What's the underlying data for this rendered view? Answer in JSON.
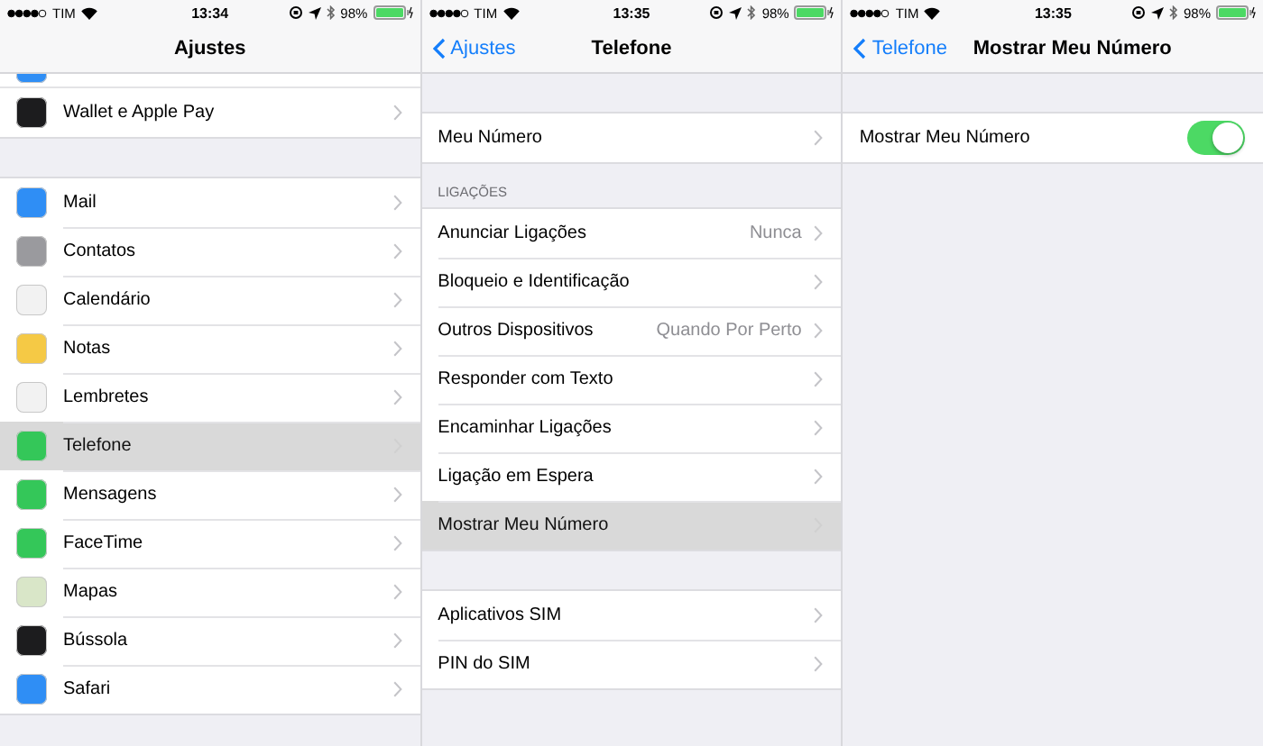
{
  "screens": [
    {
      "status_bar": {
        "carrier": "TIM",
        "time": "13:34",
        "battery": "98%"
      },
      "nav": {
        "title": "Ajustes"
      },
      "groups": [
        {
          "items": [
            {
              "kind": "clipped",
              "color": "#2f8ef5"
            },
            {
              "kind": "link",
              "label": "Wallet e Apple Pay",
              "color": "#1c1c1e",
              "selected": false
            }
          ]
        },
        {
          "items": [
            {
              "kind": "link",
              "label": "Mail",
              "color": "#2f8ef5",
              "selected": false
            },
            {
              "kind": "link",
              "label": "Contatos",
              "color": "#9a9a9e",
              "selected": false
            },
            {
              "kind": "link",
              "label": "Calendário",
              "color": "#f2f2f2",
              "selected": false
            },
            {
              "kind": "link",
              "label": "Notas",
              "color": "#f5c945",
              "selected": false
            },
            {
              "kind": "link",
              "label": "Lembretes",
              "color": "#f2f2f2",
              "selected": false
            },
            {
              "kind": "link",
              "label": "Telefone",
              "color": "#34c759",
              "selected": true
            },
            {
              "kind": "link",
              "label": "Mensagens",
              "color": "#34c759",
              "selected": false
            },
            {
              "kind": "link",
              "label": "FaceTime",
              "color": "#34c759",
              "selected": false
            },
            {
              "kind": "link",
              "label": "Mapas",
              "color": "#d9e6c8",
              "selected": false
            },
            {
              "kind": "link",
              "label": "Bússola",
              "color": "#1c1c1e",
              "selected": false
            },
            {
              "kind": "link",
              "label": "Safari",
              "color": "#2f8ef5",
              "selected": false
            }
          ]
        }
      ]
    },
    {
      "status_bar": {
        "carrier": "TIM",
        "time": "13:35",
        "battery": "98%"
      },
      "nav": {
        "back": "Ajustes",
        "title": "Telefone"
      },
      "groups": [
        {
          "items": [
            {
              "kind": "link",
              "label": "Meu Número",
              "selected": false
            }
          ]
        },
        {
          "header": "LIGAÇÕES",
          "items": [
            {
              "kind": "link",
              "label": "Anunciar Ligações",
              "value": "Nunca",
              "selected": false
            },
            {
              "kind": "link",
              "label": "Bloqueio e Identificação",
              "selected": false
            },
            {
              "kind": "link",
              "label": "Outros Dispositivos",
              "value": "Quando Por Perto",
              "selected": false
            },
            {
              "kind": "link",
              "label": "Responder com Texto",
              "selected": false
            },
            {
              "kind": "link",
              "label": "Encaminhar Ligações",
              "selected": false
            },
            {
              "kind": "link",
              "label": "Ligação em Espera",
              "selected": false
            },
            {
              "kind": "link",
              "label": "Mostrar Meu Número",
              "selected": true
            }
          ]
        },
        {
          "items": [
            {
              "kind": "link",
              "label": "Aplicativos SIM",
              "selected": false
            },
            {
              "kind": "link",
              "label": "PIN do SIM",
              "selected": false
            }
          ]
        }
      ]
    },
    {
      "status_bar": {
        "carrier": "TIM",
        "time": "13:35",
        "battery": "98%"
      },
      "nav": {
        "back": "Telefone",
        "title": "Mostrar Meu Número"
      },
      "groups": [
        {
          "items": [
            {
              "kind": "toggle",
              "label": "Mostrar Meu Número",
              "on": true
            }
          ]
        }
      ]
    }
  ]
}
